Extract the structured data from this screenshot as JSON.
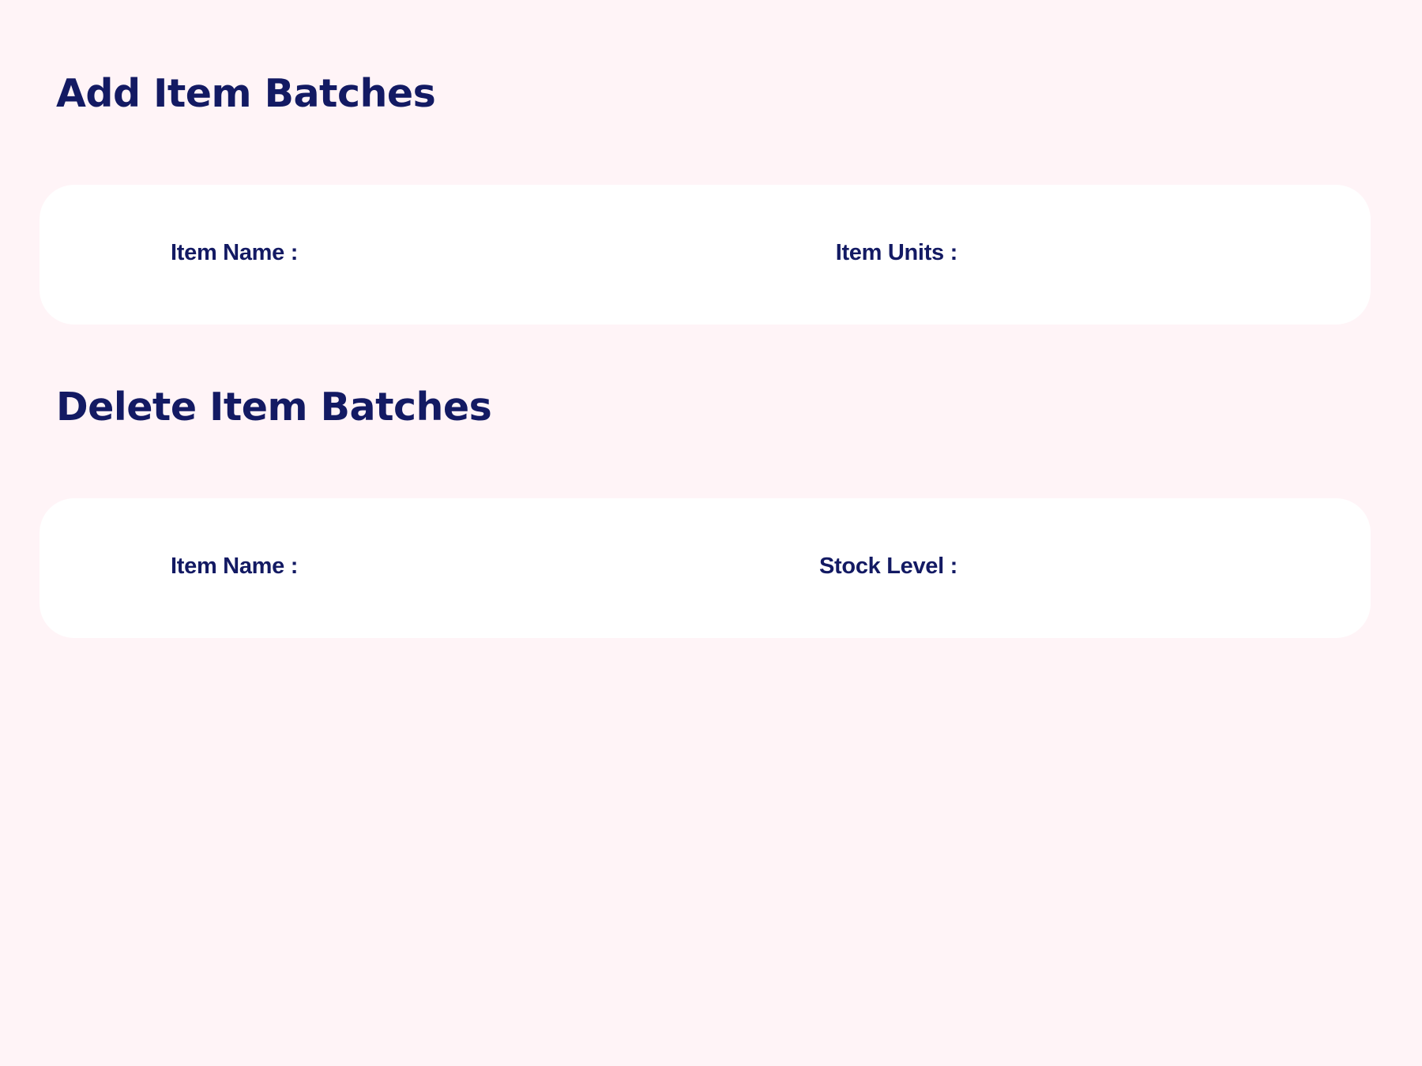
{
  "add_section": {
    "title": "Add Item Batches",
    "item_name_label": "Item Name :",
    "item_name_value": "",
    "item_units_label": "Item Units :",
    "item_units_value": ""
  },
  "delete_section": {
    "title": "Delete Item Batches",
    "item_name_label": "Item Name :",
    "item_name_value": "",
    "stock_level_label": "Stock Level :",
    "stock_level_value": ""
  },
  "colors": {
    "background": "#fff4f7",
    "card": "#ffffff",
    "text": "#131a63"
  }
}
